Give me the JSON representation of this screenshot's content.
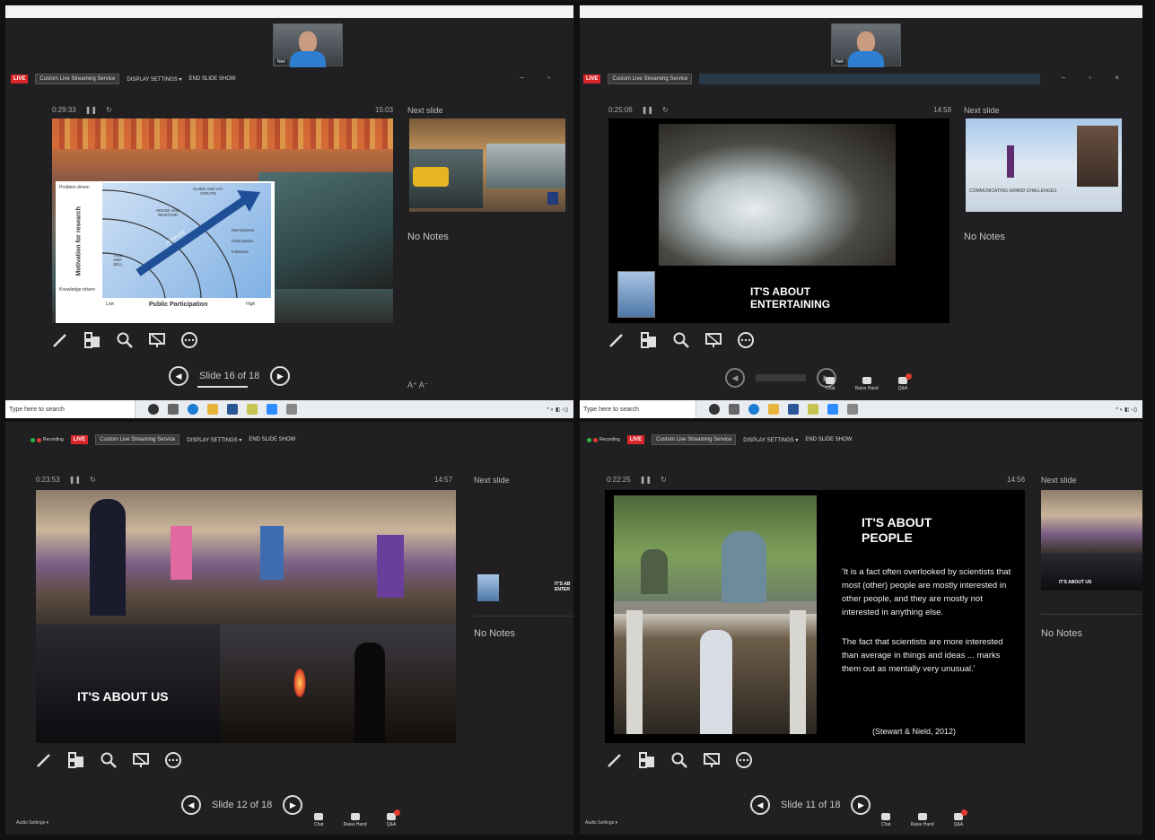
{
  "panels": [
    {
      "timer": "0:29:33",
      "clock": "15:03",
      "tab": "Custom Live Streaming Service",
      "display_settings": "DISPLAY SETTINGS ▾",
      "end_show": "END SLIDE SHOW",
      "next_label": "Next slide",
      "notes": "No Notes",
      "slide_counter": "Slide 16 of 18",
      "diagram": {
        "y_top": "Problem driven",
        "y_mid": "Motivation for research",
        "y_bottom": "Knowledge driven",
        "x_label": "Public Participation",
        "x_low": "Low",
        "x_high": "High",
        "arc1": "GUIDE AND CO-CREATE",
        "arc2": "SENSE AND RESPOND",
        "arc3": "TELL AND SELL",
        "arrow": "PURPOSE",
        "side1": "Mechanisms",
        "side2": "Participation",
        "side3": "Initiatives"
      }
    },
    {
      "timer": "0:25:06",
      "clock": "14:58",
      "tab": "Custom Live Streaming Service",
      "next_label": "Next slide",
      "notes": "No Notes",
      "slide_title": "IT'S ABOUT ENTERTAINING",
      "next_caption": "COMMUNICATING GRAND CHALLENGES"
    },
    {
      "timer": "0:23:53",
      "clock": "14:57",
      "tab": "Custom Live Streaming Service",
      "display_settings": "DISPLAY SETTINGS ▾",
      "end_show": "END SLIDE SHOW",
      "next_label": "Next slide",
      "notes": "No Notes",
      "slide_counter": "Slide 12 of 18",
      "slide_title": "IT'S ABOUT US",
      "recording": "Recording",
      "audio": "Audio Settings ▾"
    },
    {
      "timer": "0:22:25",
      "clock": "14:56",
      "tab": "Custom Live Streaming Service",
      "display_settings": "DISPLAY SETTINGS ▾",
      "end_show": "END SLIDE SHOW",
      "next_label": "Next slide",
      "notes": "No Notes",
      "slide_counter": "Slide 11 of 18",
      "slide_title": "IT'S ABOUT PEOPLE",
      "quote1": "'It is a fact often overlooked by scientists that most (other) people are mostly interested in other people, and they are mostly not interested in anything else.",
      "quote2": "The fact that scientists are more interested than average in things and ideas ... marks them out as mentally very unusual.'",
      "citation": "(Stewart & Nield, 2012)",
      "next_caption": "IT'S ABOUT US",
      "recording": "Recording",
      "audio": "Audio Settings ▾"
    }
  ],
  "taskbar": {
    "search": "Type here to search"
  },
  "zoom": {
    "chat": "Chat",
    "raise_hand": "Raise Hand",
    "qa": "Q&A"
  },
  "live_label": "LIVE",
  "colors": {
    "live": "#d9262a",
    "bg": "#202022",
    "accent": "#2e7fd1"
  }
}
